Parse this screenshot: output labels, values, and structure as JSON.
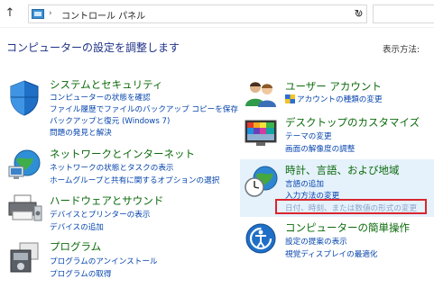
{
  "address_bar": {
    "back": "←",
    "forward": "→",
    "up": "↑",
    "path_chevron": "›",
    "path_text": "コントロール パネル",
    "dropdown": "∨",
    "refresh": "↻"
  },
  "header": {
    "title": "コンピューターの設定を調整します",
    "view_by_label": "表示方法:"
  },
  "categories": {
    "system": {
      "title": "システムとセキュリティ",
      "links": [
        "コンピューターの状態を確認",
        "ファイル履歴でファイルのバックアップ コピーを保存",
        "バックアップと復元 (Windows 7)",
        "問題の発見と解決"
      ]
    },
    "network": {
      "title": "ネットワークとインターネット",
      "links": [
        "ネットワークの状態とタスクの表示",
        "ホームグループと共有に関するオプションの選択"
      ]
    },
    "hardware": {
      "title": "ハードウェアとサウンド",
      "links": [
        "デバイスとプリンターの表示",
        "デバイスの追加"
      ]
    },
    "programs": {
      "title": "プログラム",
      "links": [
        "プログラムのアンインストール",
        "プログラムの取得"
      ]
    },
    "user_accounts": {
      "title": "ユーザー アカウント",
      "links": [
        "アカウントの種類の変更"
      ]
    },
    "desktop": {
      "title": "デスクトップのカスタマイズ",
      "links": [
        "テーマの変更",
        "画面の解像度の調整"
      ]
    },
    "clock_region": {
      "title": "時計、言語、および地域",
      "links": [
        "言語の追加",
        "入力方法の変更",
        "日付、時刻、または数値の形式の変更"
      ]
    },
    "ease_access": {
      "title": "コンピューターの簡単操作",
      "links": [
        "設定の提案の表示",
        "視覚ディスプレイの最適化"
      ]
    }
  },
  "colors": {
    "category_title": "#0b6a0b",
    "link": "#0645ad",
    "heading": "#1e3287",
    "highlight_panel": "#e5f1fb",
    "annotation_box": "#d9262f"
  }
}
